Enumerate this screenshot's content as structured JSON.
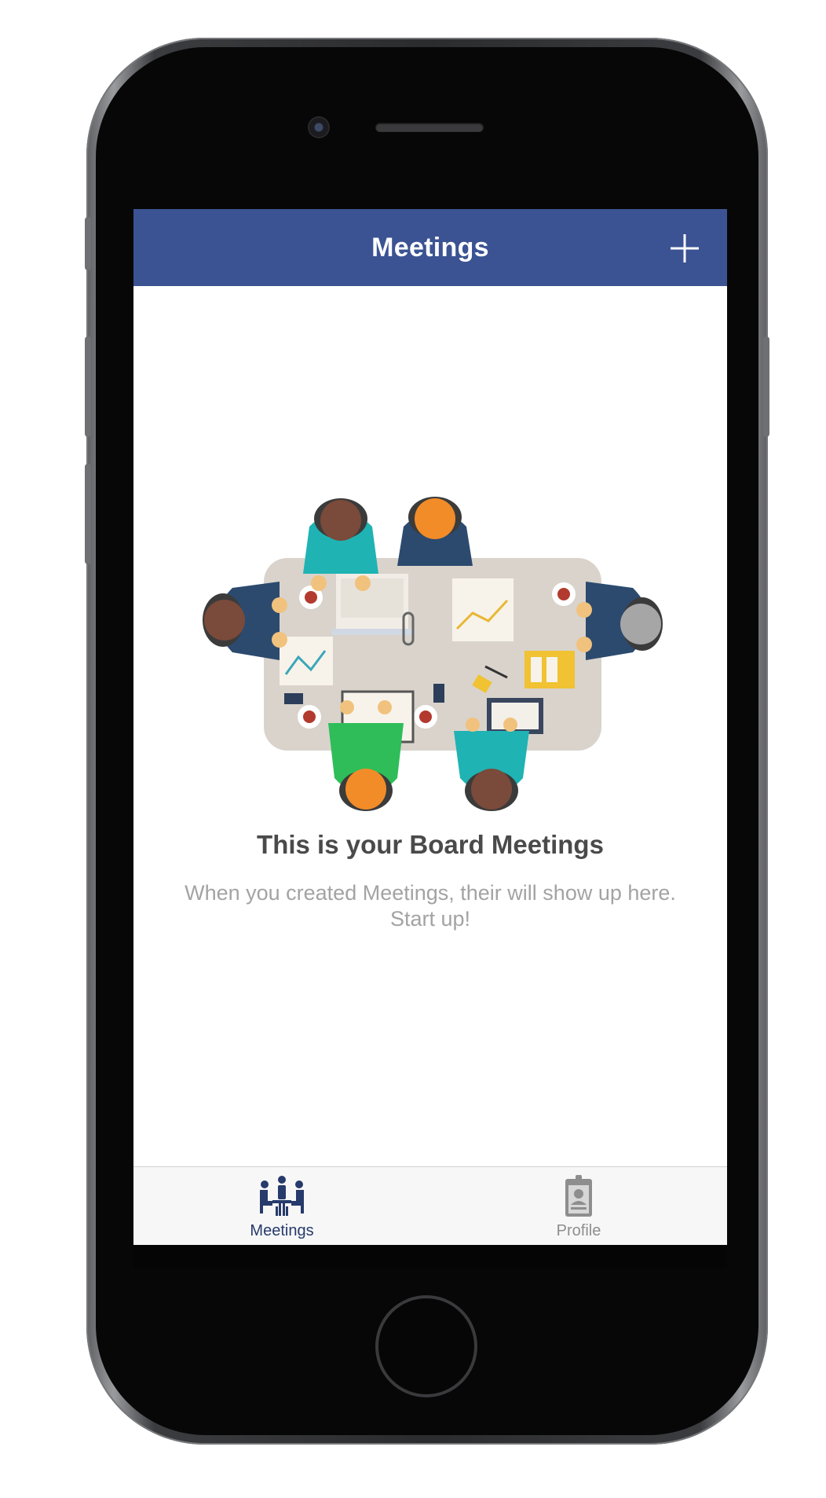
{
  "nav": {
    "title": "Meetings",
    "add_icon": "plus-icon"
  },
  "empty_state": {
    "illustration": "board-meeting-illustration",
    "title": "This is your Board Meetings",
    "description": "When you created Meetings, their will show up here. Start up!"
  },
  "tab_bar": {
    "tabs": [
      {
        "label": "Meetings",
        "icon": "meeting-group-icon",
        "selected": true
      },
      {
        "label": "Profile",
        "icon": "id-badge-icon",
        "selected": false
      }
    ]
  },
  "colors": {
    "nav_background": "#3b5393",
    "tab_selected": "#263a6b",
    "tab_unselected": "#8e8e8e",
    "title_text": "#4a4a4a",
    "description_text": "#a3a3a3"
  }
}
